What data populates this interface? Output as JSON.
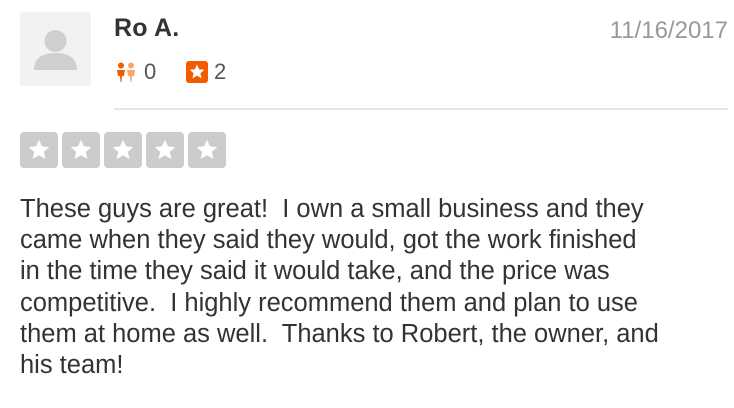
{
  "review": {
    "user": {
      "name": "Ro A.",
      "avatar_icon": "default-user-avatar-icon",
      "friends_count": "0",
      "friends_icon": "friends-icon",
      "reviews_count": "2",
      "reviews_icon": "review-star-icon"
    },
    "date": "11/16/2017",
    "rating": 5,
    "rating_max": 5,
    "rating_color": "#cccccc",
    "text": "These guys are great!  I own a small business and they\ncame when they said they would, got the work finished\nin the time they said it would take, and the price was\ncompetitive.  I highly recommend them and plan to use\nthem at home as well.  Thanks to Robert, the owner, and\nhis team!"
  },
  "colors": {
    "friends_icon": "#f15c00",
    "reviews_badge": "#f15c00",
    "date": "#999999",
    "text": "#333333"
  }
}
